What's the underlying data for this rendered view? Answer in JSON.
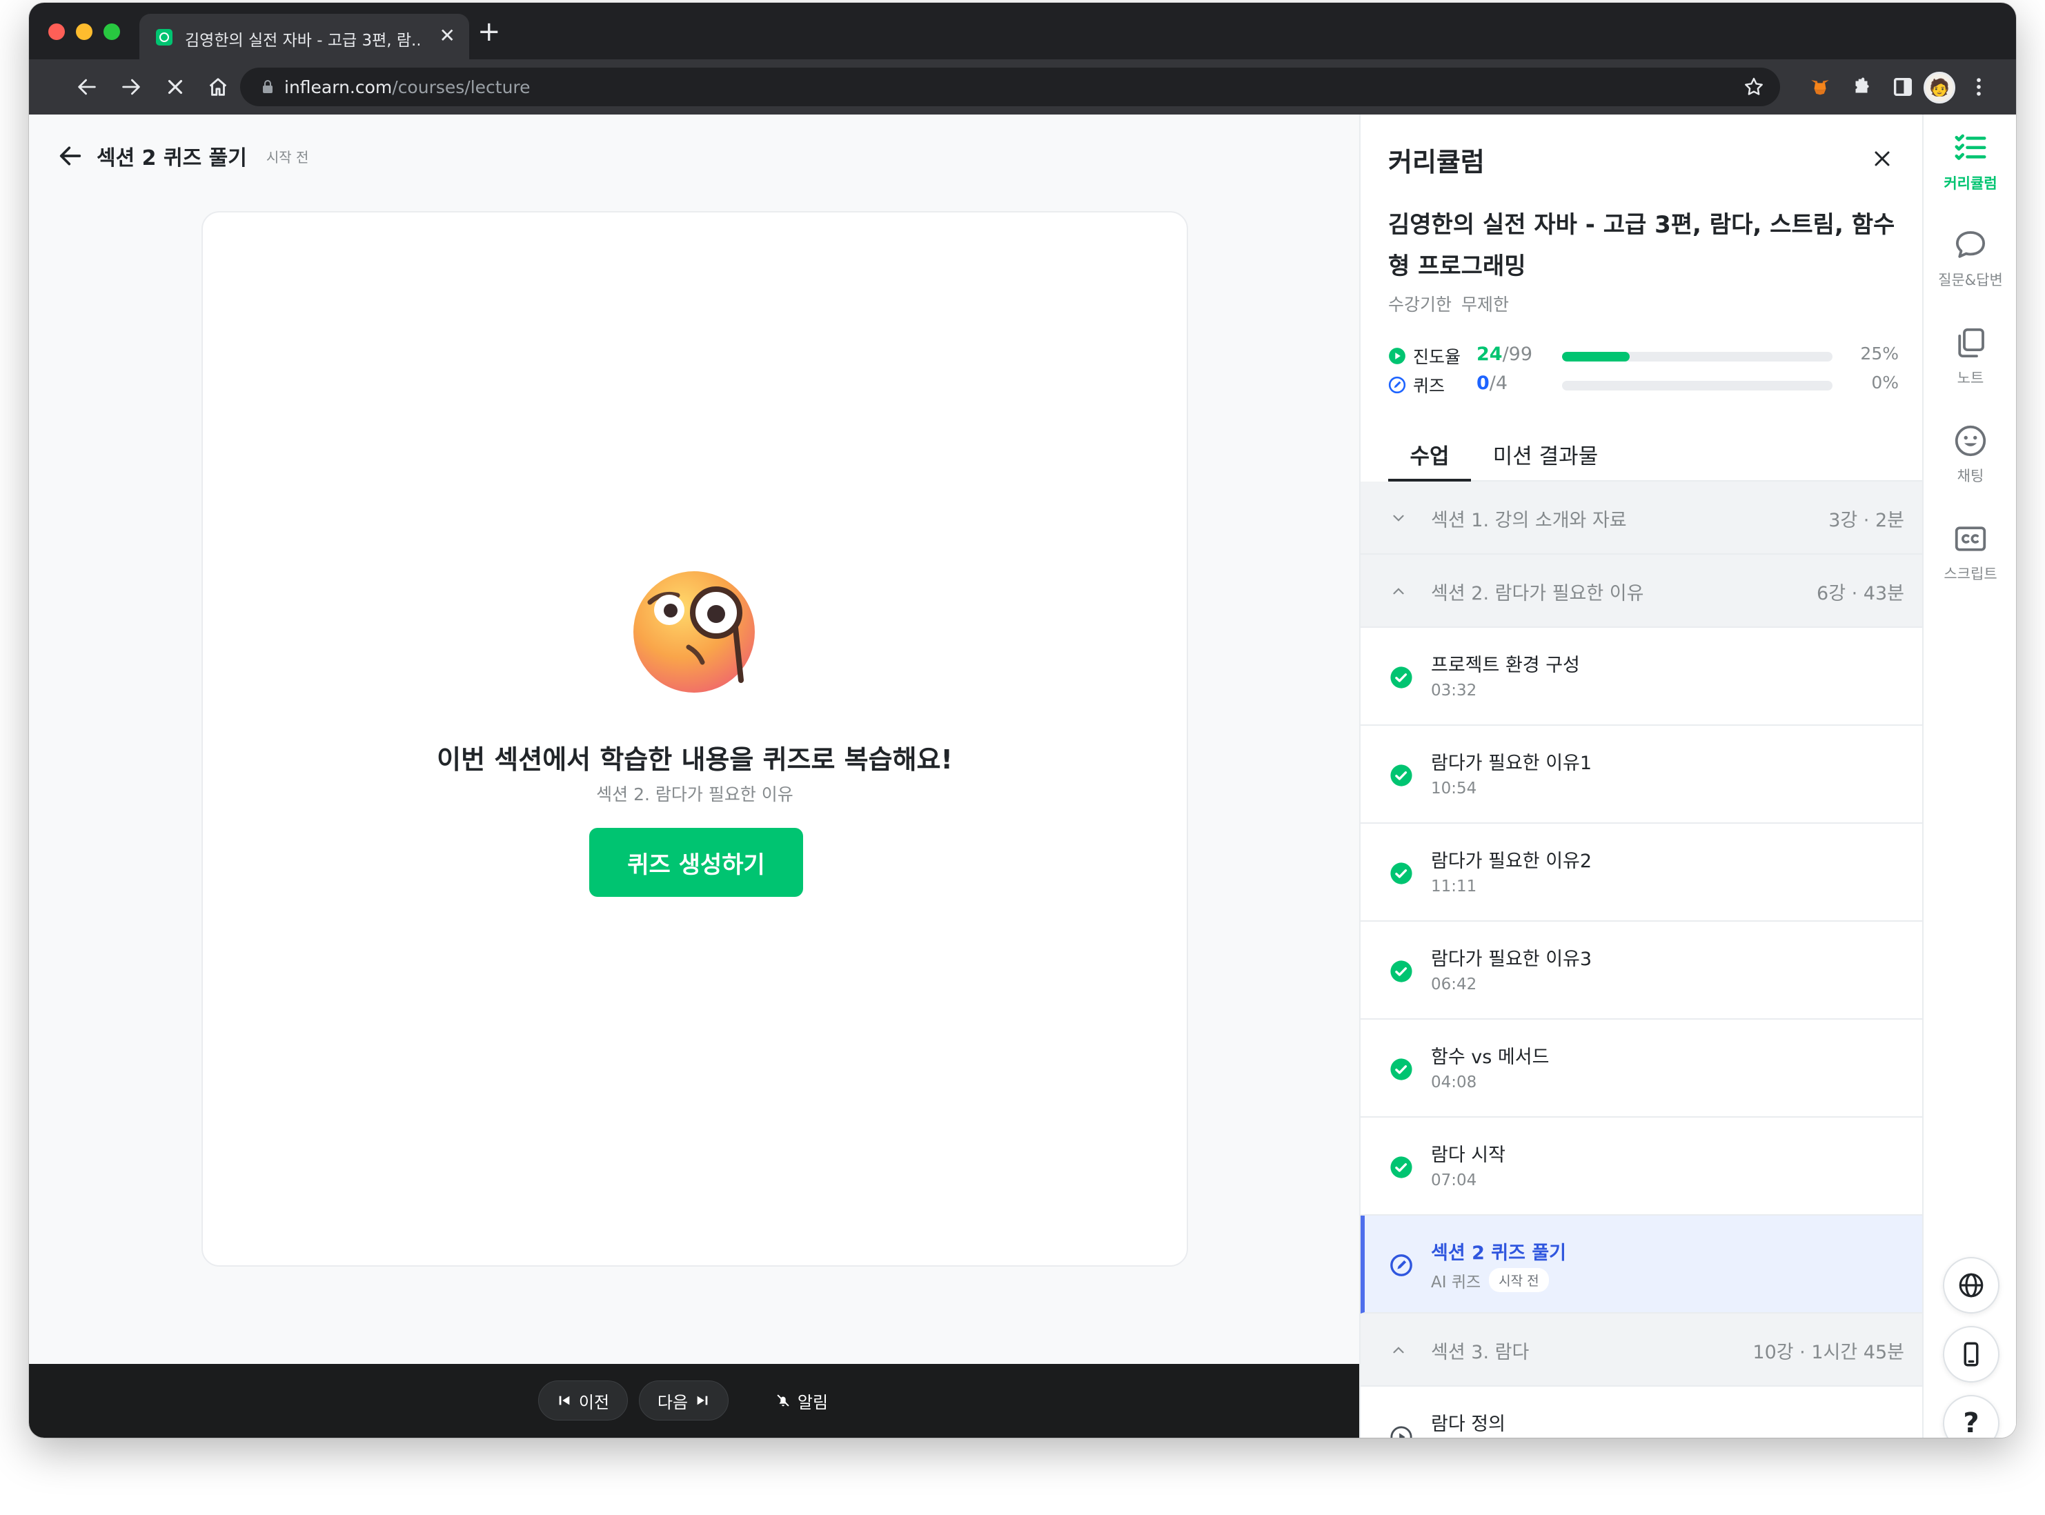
{
  "browser": {
    "tab_title": "김영한의 실전 자바 - 고급 3편, 람...",
    "url_host": "inflearn.com",
    "url_path": "/courses/lecture"
  },
  "lecture": {
    "title": "섹션 2 퀴즈 풀기",
    "status": "시작 전"
  },
  "quiz_card": {
    "heading": "이번 섹션에서 학습한 내용을 퀴즈로 복습해요!",
    "subheading": "섹션 2. 람다가 필요한 이유",
    "button_label": "퀴즈 생성하기"
  },
  "bottom_bar": {
    "prev_label": "이전",
    "next_label": "다음",
    "alarm_label": "알림"
  },
  "panel": {
    "title": "커리큘럼",
    "course_title": "김영한의 실전 자바 - 고급 3편, 람다, 스트림, 함수형 프로그래밍",
    "period_label": "수강기한",
    "period_value": "무제한",
    "progress": {
      "label": "진도율",
      "done": "24",
      "total": "/99",
      "percent_text": "25%",
      "fraction": 0.25
    },
    "quiz": {
      "label": "퀴즈",
      "done": "0",
      "total": "/4",
      "percent_text": "0%",
      "fraction": 0
    },
    "tabs": [
      "수업",
      "미션 결과물"
    ],
    "sections": [
      {
        "name": "섹션 1. 강의 소개와 자료",
        "meta": "3강 · 2분",
        "expanded": false
      },
      {
        "name": "섹션 2. 람다가 필요한 이유",
        "meta": "6강 · 43분",
        "expanded": true
      },
      {
        "name": "섹션 3. 람다",
        "meta": "10강 · 1시간 45분",
        "expanded": true
      }
    ],
    "lessons": [
      {
        "name": "프로젝트 환경 구성",
        "duration": "03:32"
      },
      {
        "name": "람다가 필요한 이유1",
        "duration": "10:54"
      },
      {
        "name": "람다가 필요한 이유2",
        "duration": "11:11"
      },
      {
        "name": "람다가 필요한 이유3",
        "duration": "06:42"
      },
      {
        "name": "함수 vs 메서드",
        "duration": "04:08"
      },
      {
        "name": "람다 시작",
        "duration": "07:04"
      }
    ],
    "current_lesson": {
      "name": "섹션 2 퀴즈 풀기",
      "kind": "AI 퀴즈",
      "badge": "시작 전"
    },
    "next_lesson": {
      "name": "람다 정의"
    }
  },
  "rail": {
    "items": [
      "커리큘럼",
      "질문&답변",
      "노트",
      "채팅",
      "스크립트"
    ],
    "help_label": "?"
  },
  "colors": {
    "brand_green": "#00c471",
    "quiz_blue": "#1e64ff",
    "current_row_bg": "#ebf1fe",
    "current_row_accent": "#4e6eec"
  }
}
